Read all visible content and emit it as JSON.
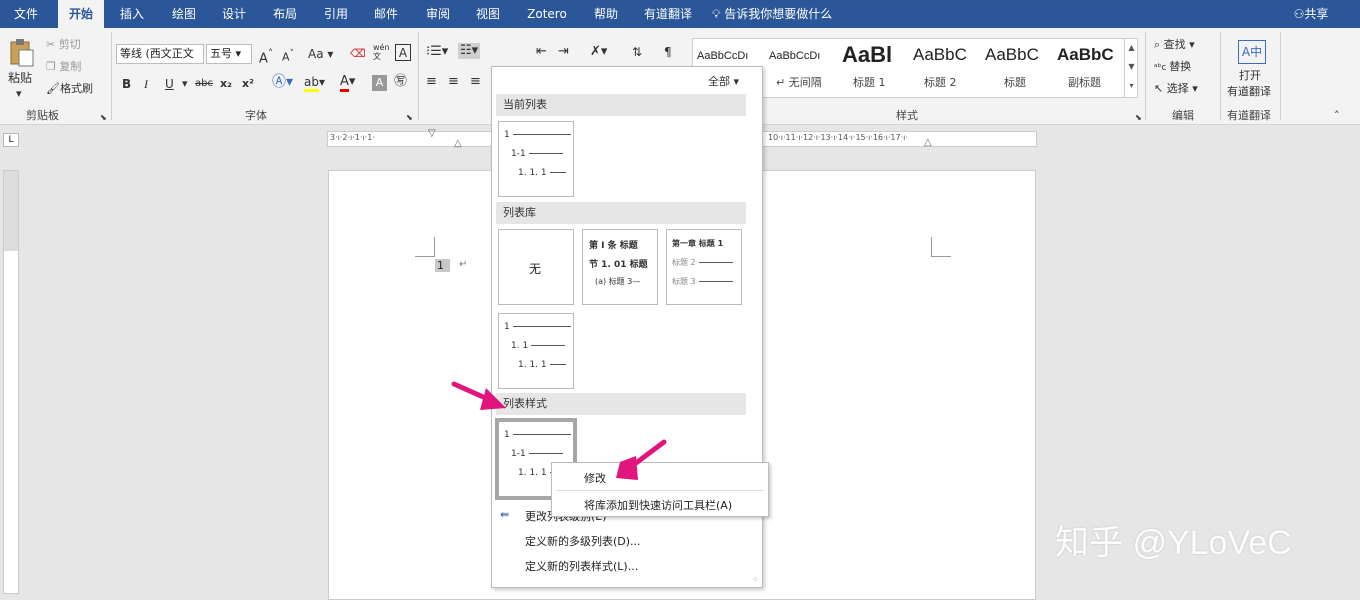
{
  "tabs": [
    "文件",
    "开始",
    "插入",
    "绘图",
    "设计",
    "布局",
    "引用",
    "邮件",
    "审阅",
    "视图",
    "Zotero",
    "帮助",
    "有道翻译"
  ],
  "tellme": "告诉我你想要做什么",
  "share": "共享",
  "clipboard": {
    "paste": "粘贴",
    "cut": "剪切",
    "copy": "复制",
    "painter": "格式刷",
    "label": "剪贴板"
  },
  "font": {
    "name": "等线 (西文正文",
    "size": "五号",
    "label": "字体",
    "grow": "A",
    "shrink": "A",
    "case": "Aa",
    "pinyin": "wén",
    "bold": "B",
    "italic": "I",
    "underline": "U",
    "strike": "abc",
    "sub": "x₂",
    "sup": "x²"
  },
  "styles": {
    "label": "样式",
    "items": [
      {
        "preview": "AaBbCcDı",
        "name": "↵ 正文"
      },
      {
        "preview": "AaBbCcDı",
        "name": "↵ 无间隔"
      },
      {
        "preview": "AaBl",
        "name": "标题 1"
      },
      {
        "preview": "AaBbC",
        "name": "标题 2"
      },
      {
        "preview": "AaBbC",
        "name": "标题"
      },
      {
        "preview": "AaBbC",
        "name": "副标题"
      }
    ]
  },
  "editing": {
    "find": "查找",
    "replace": "替换",
    "select": "选择",
    "label": "编辑"
  },
  "youdao": {
    "open1": "打开",
    "open2": "有道翻译",
    "label": "有道翻译"
  },
  "ruler": {
    "left": "3·ı·2·ı·1·ı·1·",
    "right": "10·ı·11·ı·12·ı·13·ı·14·ı·15·ı·16·ı·17·ı·"
  },
  "document": {
    "number": "1",
    "mark": "↵"
  },
  "dropdown": {
    "filter": "全部 ▾",
    "current_header": "当前列表",
    "library_header": "列表库",
    "styles_header": "列表样式",
    "none": "无",
    "thumb_generic": [
      "1",
      "1-1",
      "1. 1. 1"
    ],
    "thumb_generic2": [
      "1",
      "1. 1",
      "1. 1. 1"
    ],
    "thumb_zh1": [
      "第 Ⅰ 条 标题",
      "节 1. 01 标题",
      "(a) 标题 3—"
    ],
    "thumb_zh2": [
      "第一章 标题 1",
      "标题 2",
      "标题 3"
    ],
    "change_level": "更改列表级别(E)",
    "define_multi": "定义新的多级列表(D)...",
    "define_style": "定义新的列表样式(L)..."
  },
  "context": {
    "modify": "修改",
    "add_qat": "将库添加到快速访问工具栏(A)"
  },
  "watermark": "知乎 @YLoVeC",
  "colors": {
    "accent": "#2b579a",
    "arrow": "#e0157d"
  }
}
